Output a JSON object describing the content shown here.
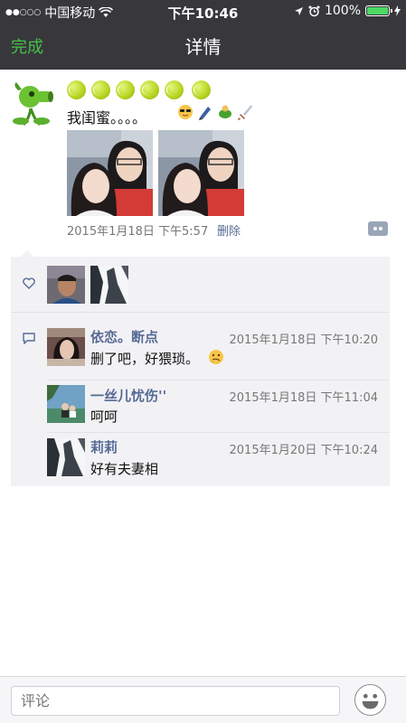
{
  "status_bar": {
    "carrier": "中国移动",
    "time": "下午10:46",
    "battery": "100%"
  },
  "nav": {
    "done_label": "完成",
    "title": "详情"
  },
  "post": {
    "text": "我闺蜜。。。。",
    "date": "2015年1月18日 下午5:57",
    "delete_label": "删除"
  },
  "comments": [
    {
      "name": "依恋。断点",
      "time": "2015年1月18日 下午10:20",
      "text": "删了吧，好猥琐。"
    },
    {
      "name": "一丝儿忧伤''",
      "time": "2015年1月18日 下午11:04",
      "text": "呵呵"
    },
    {
      "name": "莉莉",
      "time": "2015年1月20日 下午10:24",
      "text": "好有夫妻相"
    }
  ],
  "bottom": {
    "comment_placeholder": "评论"
  },
  "colors": {
    "nav_background": "#38383c",
    "done_green": "#44c14b",
    "link_blue": "#576b95",
    "panel_background": "#f2f2f5"
  },
  "icons": [
    "wifi-icon",
    "location-icon",
    "alarm-icon",
    "battery-icon",
    "charging-icon",
    "heart-icon",
    "comment-icon",
    "more-icon",
    "smiley-icon"
  ]
}
